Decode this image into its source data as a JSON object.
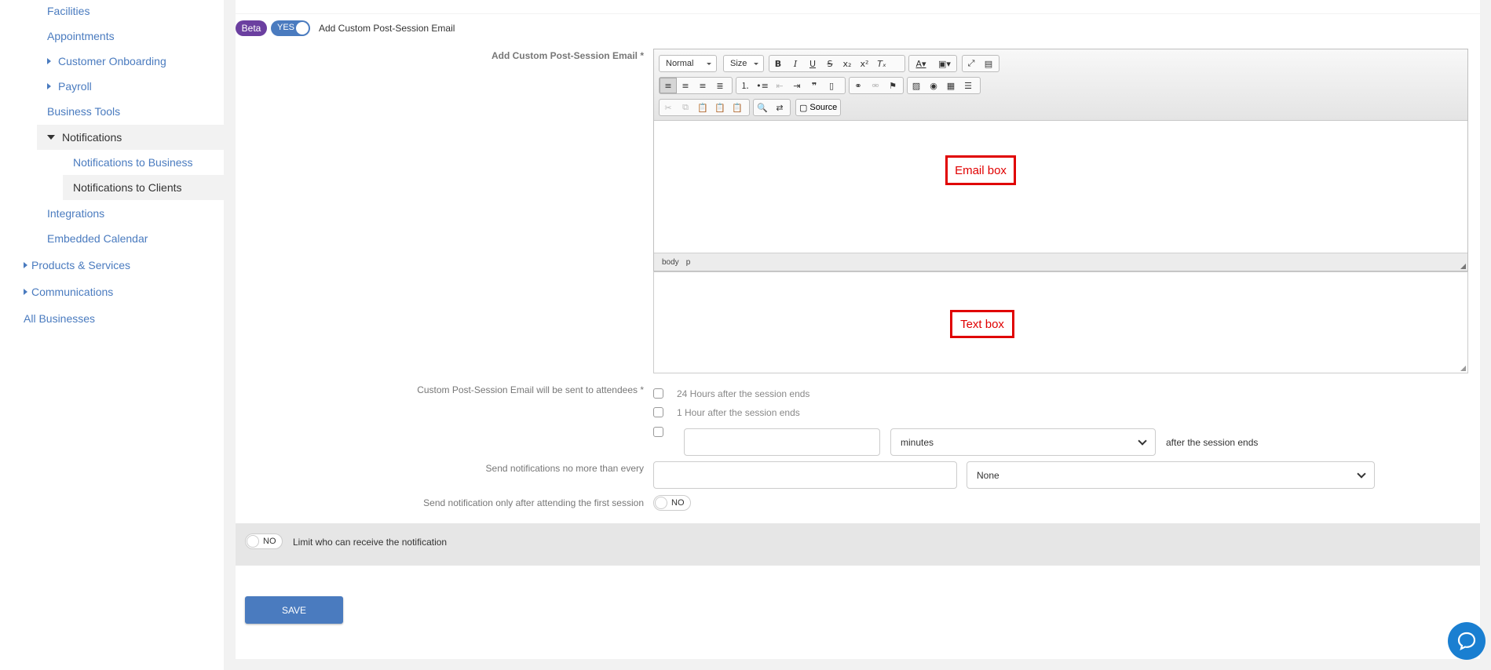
{
  "sidebar": {
    "items": [
      {
        "label": "Facilities"
      },
      {
        "label": "Appointments"
      },
      {
        "label": "Customer Onboarding"
      },
      {
        "label": "Payroll"
      },
      {
        "label": "Business Tools"
      },
      {
        "label": "Notifications"
      },
      {
        "label": "Notifications to Business"
      },
      {
        "label": "Notifications to Clients"
      },
      {
        "label": "Integrations"
      },
      {
        "label": "Embedded Calendar"
      },
      {
        "label": "Products & Services"
      },
      {
        "label": "Communications"
      },
      {
        "label": "All Businesses"
      }
    ]
  },
  "header": {
    "beta_label": "Beta",
    "toggle_label": "YES",
    "title": "Add Custom Post-Session Email"
  },
  "editor": {
    "field_label": "Add Custom Post-Session Email *",
    "format_combo": "Normal",
    "size_combo": "Size",
    "source_label": "Source",
    "statusbar": [
      "body",
      "p"
    ],
    "email_annotation": "Email box",
    "text_annotation": "Text box"
  },
  "schedule": {
    "label": "Custom Post-Session Email will be sent to attendees *",
    "option1": "24 Hours after the session ends",
    "option2": "1 Hour after the session ends",
    "custom_value": "",
    "unit": "minutes",
    "suffix": "after the session ends"
  },
  "frequency": {
    "label": "Send notifications no more than every",
    "value": "",
    "unit": "None"
  },
  "first_session": {
    "label": "Send notification only after attending the first session",
    "toggle": "NO"
  },
  "limit": {
    "toggle": "NO",
    "label": "Limit who can receive the notification"
  },
  "actions": {
    "save": "SAVE"
  },
  "colors": {
    "accent": "#4a7bbf",
    "beta": "#6b3fa0",
    "annotation": "#e00000",
    "chat": "#1a7fd1"
  }
}
